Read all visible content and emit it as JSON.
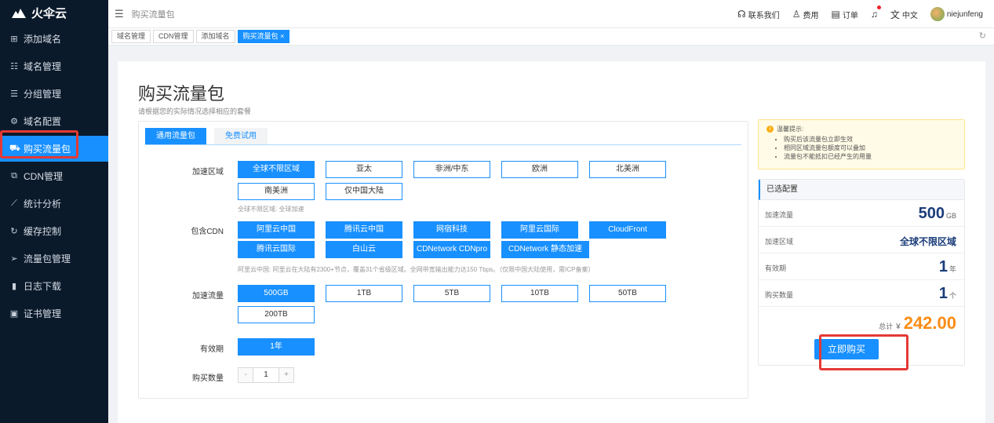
{
  "app": {
    "name": "火伞云"
  },
  "sidebar": {
    "items": [
      {
        "label": "添加域名",
        "icon": "plus-square-icon"
      },
      {
        "label": "域名管理",
        "icon": "list-icon"
      },
      {
        "label": "分组管理",
        "icon": "group-list-icon"
      },
      {
        "label": "域名配置",
        "icon": "gear-icon"
      },
      {
        "label": "购买流量包",
        "icon": "cart-icon",
        "active": true
      },
      {
        "label": "CDN管理",
        "icon": "cdn-icon"
      },
      {
        "label": "统计分析",
        "icon": "chart-icon"
      },
      {
        "label": "缓存控制",
        "icon": "refresh-icon"
      },
      {
        "label": "流量包管理",
        "icon": "send-icon"
      },
      {
        "label": "日志下载",
        "icon": "file-icon"
      },
      {
        "label": "证书管理",
        "icon": "certificate-icon"
      }
    ]
  },
  "header": {
    "breadcrumb": "购买流量包",
    "contact": "联系我们",
    "fees": "费用",
    "orders": "订单",
    "lang": "中文",
    "username": "niejunfeng"
  },
  "tabs": [
    {
      "label": "域名管理"
    },
    {
      "label": "CDN管理"
    },
    {
      "label": "添加域名"
    },
    {
      "label": "购买流量包",
      "close": "×",
      "active": true
    }
  ],
  "page": {
    "title": "购买流量包",
    "subtitle": "请根据您的实际情况选择相应的套餐"
  },
  "form": {
    "tabs": [
      "通用流量包",
      "免费试用"
    ],
    "region": {
      "label": "加速区域",
      "options": [
        "全球不限区域",
        "亚太",
        "非洲/中东",
        "欧洲",
        "北美洲",
        "南美洲",
        "仅中国大陆"
      ],
      "hint": "全球不限区域: 全球加速"
    },
    "cdn": {
      "label": "包含CDN",
      "options": [
        "阿里云中国",
        "腾讯云中国",
        "网宿科技",
        "阿里云国际",
        "CloudFront",
        "腾讯云国际",
        "白山云",
        "CDNetwork CDNpro",
        "CDNetwork 静态加速"
      ],
      "hint": "阿里云中国: 阿里云在大陆有2300+节点，覆盖31个省级区域。全网带宽输出能力达150 Tbps。（仅限中国大陆使用，需ICP备案）"
    },
    "traffic": {
      "label": "加速流量",
      "options": [
        "500GB",
        "1TB",
        "5TB",
        "10TB",
        "50TB",
        "200TB"
      ]
    },
    "period": {
      "label": "有效期",
      "options": [
        "1年"
      ]
    },
    "quantity": {
      "label": "购买数量",
      "minus": "-",
      "value": "1",
      "plus": "+"
    }
  },
  "tips": {
    "title": "温馨提示:",
    "items": [
      "购买后该流量包立即生效",
      "相同区域流量包额度可以叠加",
      "流量包不能抵扣已经产生的用量"
    ]
  },
  "summary": {
    "title": "已选配置",
    "traffic_label": "加速流量",
    "traffic_value": "500",
    "traffic_unit": "GB",
    "region_label": "加速区域",
    "region_value": "全球不限区域",
    "period_label": "有效期",
    "period_value": "1",
    "period_unit": "年",
    "quantity_label": "购买数量",
    "quantity_value": "1",
    "quantity_unit": "个",
    "total_label": "总计",
    "currency": "¥",
    "total_value": "242.00",
    "buy_label": "立即购买"
  },
  "colors": {
    "accent": "#1890ff",
    "sidebar": "#0b1a2b",
    "price": "#fa8c16",
    "highlight": "#e53935"
  }
}
